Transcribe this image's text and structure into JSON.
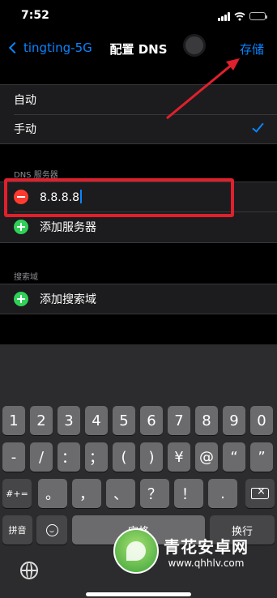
{
  "status_bar": {
    "time": "7:52"
  },
  "nav": {
    "back_label": "tingting-5G",
    "title": "配置 DNS",
    "save_label": "存储"
  },
  "mode_group": {
    "items": [
      {
        "label": "自动"
      },
      {
        "label": "手动",
        "selected": true
      }
    ]
  },
  "dns_section": {
    "header": "DNS 服务器",
    "server_value": "8.8.8.8",
    "add_label": "添加服务器"
  },
  "search_section": {
    "header": "搜索域",
    "add_label": "添加搜索域"
  },
  "keyboard": {
    "row1": [
      "1",
      "2",
      "3",
      "4",
      "5",
      "6",
      "7",
      "8",
      "9",
      "0"
    ],
    "row2": [
      "-",
      "/",
      "：",
      "；",
      "(",
      ")",
      "¥",
      "@",
      "“",
      "”"
    ],
    "row3_left": "#+=",
    "row3": [
      "。",
      "，",
      "、",
      "？",
      "！",
      "."
    ],
    "pinyin": "拼音",
    "space": "空格",
    "return": "换行"
  },
  "watermark": {
    "name": "青花安卓网",
    "url": "www.qhhlv.com"
  },
  "colors": {
    "accent": "#0a84ff",
    "highlight": "#e0202c",
    "add": "#30d158",
    "remove": "#ff3b30"
  }
}
